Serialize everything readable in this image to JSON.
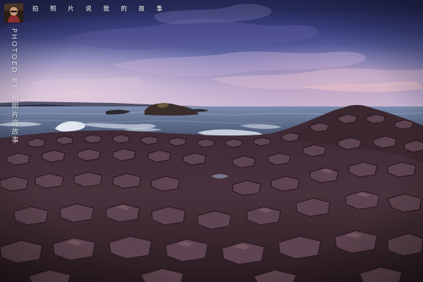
{
  "watermark": {
    "caption": "拍照片说我的故事",
    "credit": "PHOTOED BY 拍照片说故事"
  },
  "avatar": {
    "icon": "photographer-avatar-icon"
  },
  "photo": {
    "subject": "basalt-column-coastline-at-dusk",
    "colors": {
      "sky_top": "#232a5a",
      "sky_mid": "#5a5f9a",
      "sky_glow": "#c9a7c7",
      "sea": "#5a6f8e",
      "foam": "#e8eef7",
      "rock_dark": "#2c1e26",
      "rock_mid": "#5a3f49",
      "rock_light": "#8a6a72"
    }
  }
}
